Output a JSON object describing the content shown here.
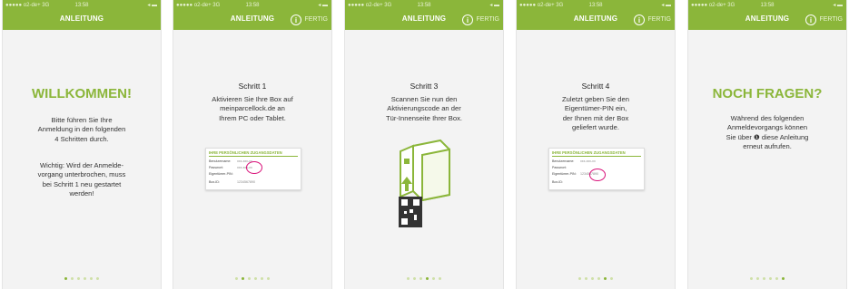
{
  "status_bar": {
    "carrier": "●●●●● o2-de+  3G",
    "time": "13:58",
    "right": "◂ ▬"
  },
  "nav": {
    "title": "ANLEITUNG",
    "info_glyph": "i",
    "done": "FERTIG"
  },
  "screens": [
    {
      "heading": "WILLKOMMEN!",
      "body": "Bitte führen Sie Ihre\nAnmeldung in den folgenden\n4 Schritten durch.",
      "body2": "Wichtig: Wird der Anmelde-\nvorgang unterbrochen, muss\nbei Schritt 1 neu gestartet\nwerden!",
      "active_dot": 0
    },
    {
      "step": "Schritt 1",
      "body": "Aktivieren Sie Ihre Box auf\nmeinparcellock.de an\nIhrem PC oder Tablet.",
      "active_dot": 1
    },
    {
      "step": "Schritt 3",
      "body": "Scannen Sie nun den\nAktivierungscode an der\nTür-Innenseite Ihrer Box.",
      "active_dot": 3
    },
    {
      "step": "Schritt 4",
      "body": "Zuletzt geben Sie den\nEigentümer-PIN ein,\nder Ihnen mit der Box\ngeliefert wurde.",
      "active_dot": 4
    },
    {
      "heading": "NOCH FRAGEN?",
      "body": "Während des folgenden\nAnmeldevorgangs können\nSie über ❶ diese Anleitung\nerneut aufrufen.",
      "active_dot": 5
    }
  ],
  "card": {
    "title": "IHRE PERSÖNLICHEN ZUGANGSDATEN",
    "rows": [
      {
        "label": "Benutzername:",
        "value": "xxx-xxx-xx"
      },
      {
        "label": "Passwort:",
        "value": "xxx-xxx-xx"
      },
      {
        "label": "Eigentümer-PIN:",
        "value": "1234567890"
      },
      {
        "label": "Box-ID:",
        "value": "1234567890"
      }
    ]
  },
  "colors": {
    "accent": "#8bb63a",
    "highlight": "#d9127a"
  }
}
